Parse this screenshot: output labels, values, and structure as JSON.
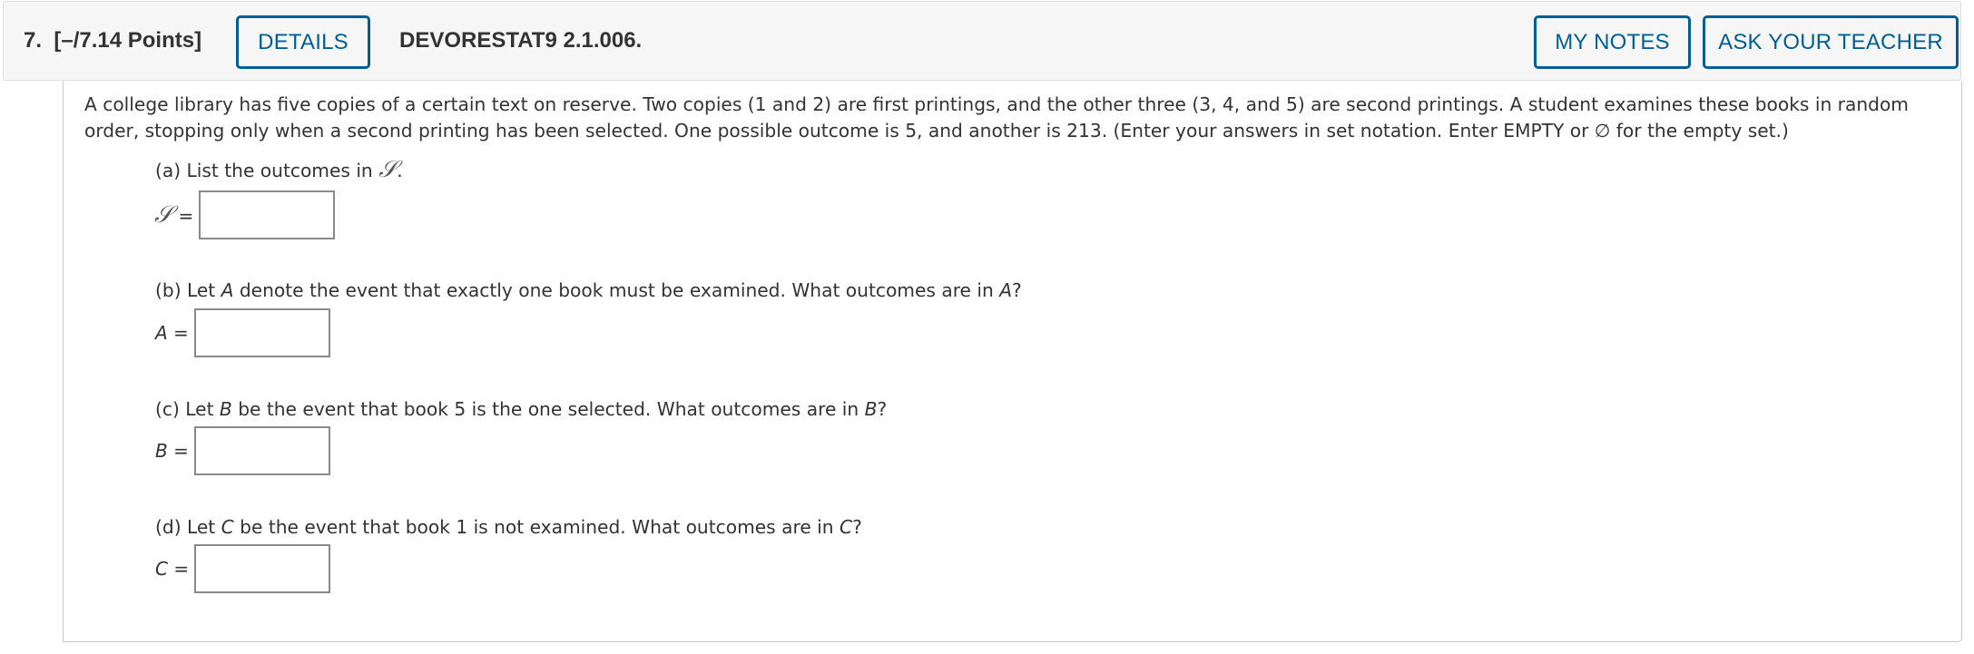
{
  "header": {
    "question_number": "7.",
    "points": "[–/7.14 Points]",
    "details_label": "DETAILS",
    "question_code": "DEVORESTAT9 2.1.006.",
    "my_notes_label": "MY NOTES",
    "ask_teacher_label": "ASK YOUR TEACHER",
    "accent_color": "#005e96"
  },
  "prompt": "A college library has five copies of a certain text on reserve. Two copies (1 and 2) are first printings, and the other three (3, 4, and 5) are second printings. A student examines these books in random order, stopping only when a second printing has been selected. One possible outcome is 5, and another is 213. (Enter your answers in set notation. Enter EMPTY or ∅ for the empty set.)",
  "parts": [
    {
      "id": "a",
      "prefix": "(a) List the outcomes in ",
      "var": "𝒮",
      "suffix": ".",
      "answer_var": "𝒮",
      "answer_eq": "=",
      "value": ""
    },
    {
      "id": "b",
      "prefix": "(b) Let ",
      "var": "A",
      "middle": " denote the event that exactly one book must be examined. What outcomes are in ",
      "var2": "A",
      "suffix": "?",
      "answer_var": "A",
      "answer_eq": "=",
      "value": ""
    },
    {
      "id": "c",
      "prefix": "(c) Let ",
      "var": "B",
      "middle": " be the event that book 5 is the one selected. What outcomes are in ",
      "var2": "B",
      "suffix": "?",
      "answer_var": "B",
      "answer_eq": "=",
      "value": ""
    },
    {
      "id": "d",
      "prefix": "(d) Let ",
      "var": "C",
      "middle": " be the event that book 1 is not examined. What outcomes are in ",
      "var2": "C",
      "suffix": "?",
      "answer_var": "C",
      "answer_eq": "=",
      "value": ""
    }
  ]
}
